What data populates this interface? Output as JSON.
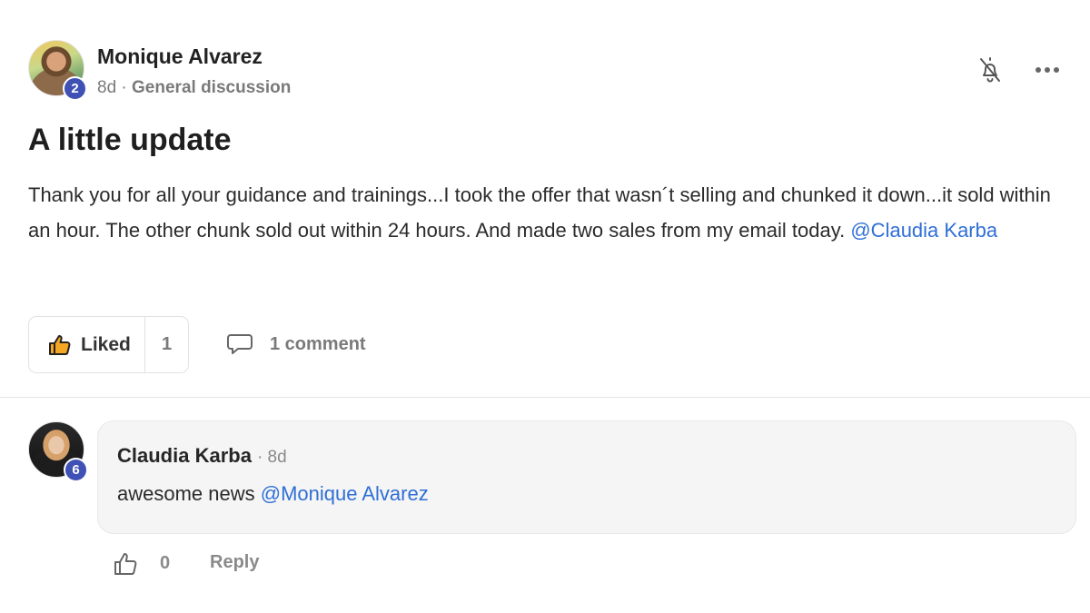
{
  "post": {
    "author": {
      "name": "Monique Alvarez",
      "level": "2"
    },
    "age": "8d",
    "separator": "·",
    "category": "General discussion",
    "title": "A little update",
    "body_text": "Thank you for all your guidance and trainings...I took the offer that wasn´t selling and chunked it down...it sold within an hour. The other chunk sold out within 24 hours. And made two sales from my email today. ",
    "body_mention": "@Claudia Karba",
    "like_label": "Liked",
    "like_count": "1",
    "comment_label": "1 comment"
  },
  "comment": {
    "author": {
      "name": "Claudia Karba",
      "level": "6"
    },
    "meta": "· 8d",
    "text": "awesome news ",
    "mention": "@Monique Alvarez",
    "like_count": "0",
    "reply_label": "Reply"
  },
  "icons": {
    "notification": "bell-off-icon",
    "more": "more-horizontal-icon",
    "like_filled": "thumbs-up-filled-icon",
    "comment": "speech-bubble-icon",
    "like_outline": "thumbs-up-outline-icon"
  },
  "colors": {
    "mention": "#2f6fd6",
    "badge": "#3f51b5",
    "like_accent": "#f5a623"
  }
}
